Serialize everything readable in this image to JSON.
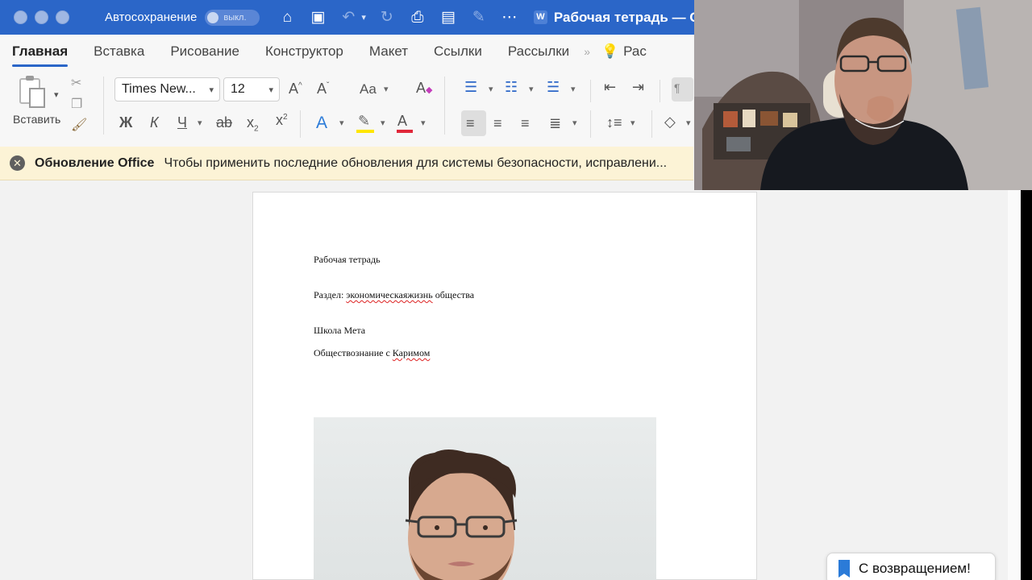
{
  "titlebar": {
    "autosave_label": "Автосохранение",
    "autosave_state": "выкл.",
    "doc_title": "Рабочая тетрадь — С",
    "window_buttons": [
      "close",
      "minimize",
      "zoom"
    ]
  },
  "tabs": [
    {
      "label": "Главная",
      "active": true
    },
    {
      "label": "Вставка"
    },
    {
      "label": "Рисование"
    },
    {
      "label": "Конструктор"
    },
    {
      "label": "Макет"
    },
    {
      "label": "Ссылки"
    },
    {
      "label": "Рассылки"
    }
  ],
  "tabs_overflow": "Рас",
  "ribbon": {
    "paste_label": "Вставить",
    "font_name": "Times New...",
    "font_size": "12",
    "bold": "Ж",
    "italic": "К",
    "underline": "Ч",
    "strike": "ab",
    "subscript": "x",
    "superscript": "x",
    "grow_font": "A",
    "shrink_font": "A",
    "change_case": "Aa",
    "clear_format": "A",
    "text_effects": "A",
    "font_color": "A"
  },
  "update_bar": {
    "title": "Обновление Office",
    "message": "Чтобы применить последние обновления для системы безопасности, исправлени..."
  },
  "document": {
    "paragraphs": [
      {
        "text": "Рабочая тетрадь"
      },
      {
        "prefix": "Раздел: ",
        "misspelled": "экономическаяжизнь",
        "suffix": " общества"
      },
      {
        "text": "Школа Мета"
      },
      {
        "prefix": "Обществознание с ",
        "misspelled": "Каримом",
        "suffix": ""
      }
    ]
  },
  "toast": {
    "text": "С возвращением!"
  },
  "colors": {
    "titlebar": "#2b66c8",
    "ribbon": "#f7f7f7",
    "update_bar": "#fcf3d6",
    "highlight": "#ffe600",
    "font_color": "#e0283a",
    "accent": "#2b66c8"
  }
}
